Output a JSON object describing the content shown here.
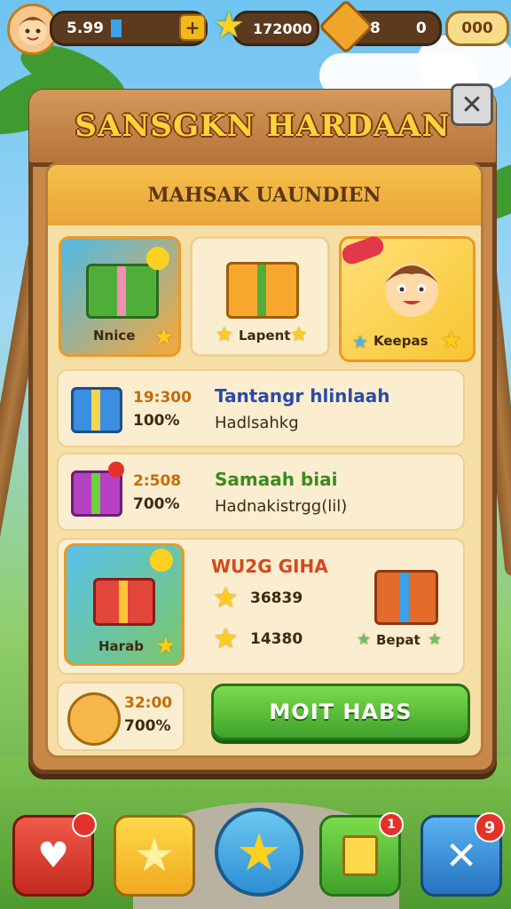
{
  "hud": {
    "level_value": "5.99",
    "stars_value": "172000",
    "gold_value": "8",
    "gold_extra": "0",
    "gems_value": "000",
    "plus_label": "+"
  },
  "panel": {
    "title": "SANSGKN HARDAAN",
    "subtitle": "MAHSAK UAUNDIEN",
    "close_label": "✕"
  },
  "top_cards": [
    {
      "label": "Nnice"
    },
    {
      "label": "Lapent"
    },
    {
      "label": "Keepas"
    }
  ],
  "rows": [
    {
      "amount": "19:300",
      "pct": "100%",
      "title": "Tantangr hlinlaah",
      "subtitle": "Hadlsahkg"
    },
    {
      "amount": "2:508",
      "pct": "700%",
      "title": "Samaah biai",
      "subtitle": "Hadnakistrgg(lil)"
    }
  ],
  "featured": {
    "card_label": "Harab",
    "title": "WU2G GIHA",
    "stat1": "36839",
    "stat2": "14380",
    "gift_label": "Bepat"
  },
  "bottom_row": {
    "amount": "32:00",
    "pct": "700%",
    "button_label": "MOIT HABS"
  },
  "nav": {
    "badge_heart": "",
    "badge_book": "1",
    "badge_tools": "9"
  },
  "colors": {
    "panel": "#c8884a",
    "title_text": "#ffd23e",
    "green_button": "#3fa22a",
    "amount_text": "#c56b0a"
  }
}
